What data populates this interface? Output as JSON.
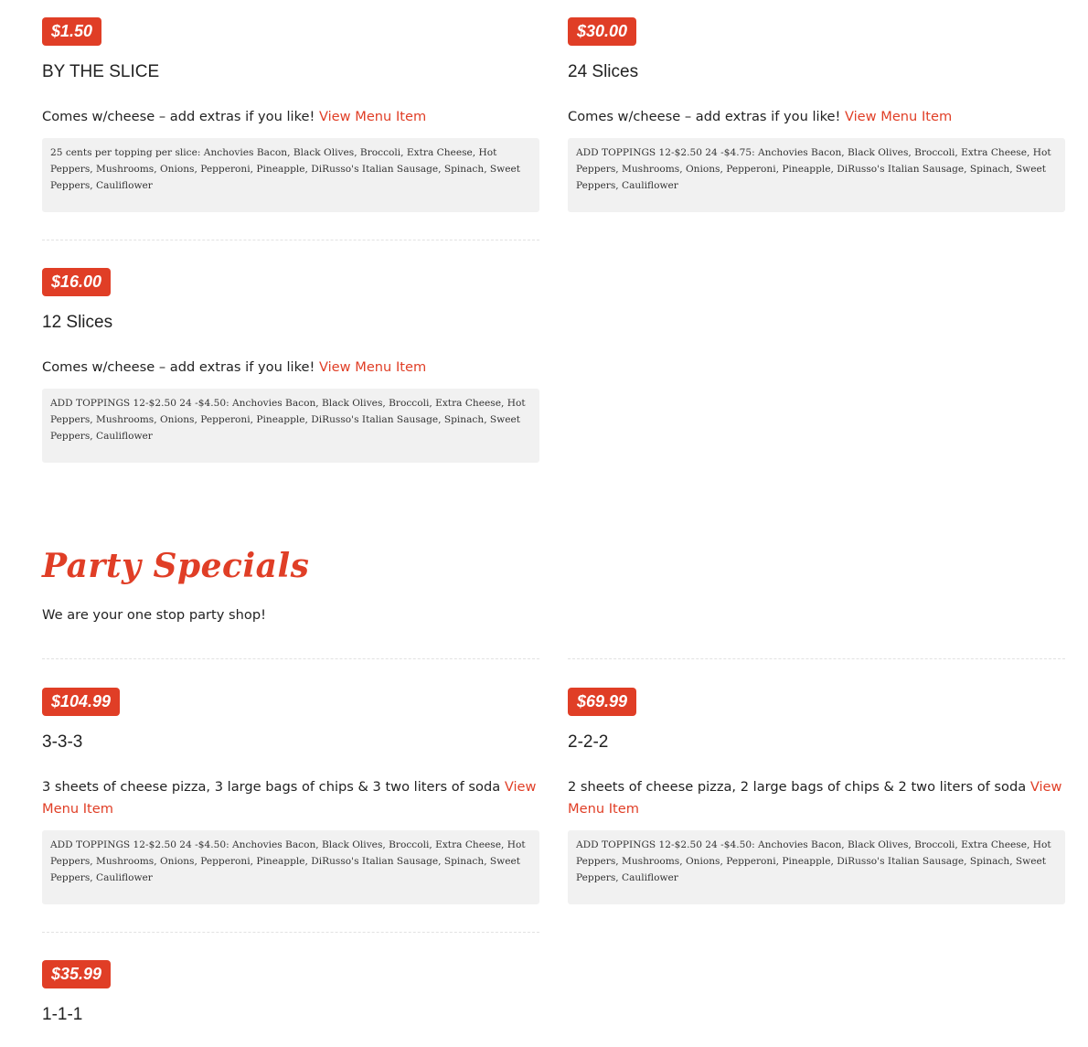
{
  "link_label": "View Menu Item",
  "items": [
    {
      "price": "$1.50",
      "name": "BY THE SLICE",
      "description": "Comes w/cheese – add extras if you like!",
      "toppings": "25 cents per topping per slice: Anchovies Bacon, Black Olives, Broccoli, Extra Cheese, Hot Peppers, Mushrooms, Onions, Pepperoni, Pineapple, DiRusso's Italian Sausage, Spinach, Sweet Peppers, Cauliflower"
    },
    {
      "price": "$30.00",
      "name": "24 Slices",
      "description": "Comes w/cheese – add extras if you like!",
      "toppings": "ADD TOPPINGS 12-$2.50 24 -$4.75: Anchovies Bacon, Black Olives, Broccoli, Extra Cheese, Hot Peppers, Mushrooms, Onions, Pepperoni, Pineapple, DiRusso's Italian Sausage, Spinach, Sweet Peppers, Cauliflower"
    },
    {
      "price": "$16.00",
      "name": "12 Slices",
      "description": "Comes w/cheese – add extras if you like!",
      "toppings": "ADD TOPPINGS 12-$2.50 24 -$4.50: Anchovies Bacon, Black Olives, Broccoli, Extra Cheese, Hot Peppers, Mushrooms, Onions, Pepperoni, Pineapple, DiRusso's Italian Sausage, Spinach, Sweet Peppers, Cauliflower"
    }
  ],
  "party": {
    "title": "Party Specials",
    "subtitle": "We are your one stop party shop!",
    "items": [
      {
        "price": "$104.99",
        "name": "3-3-3",
        "description": "3 sheets of cheese pizza, 3 large bags of chips & 3 two liters of soda",
        "toppings": "ADD TOPPINGS 12-$2.50 24 -$4.50: Anchovies Bacon, Black Olives, Broccoli, Extra Cheese, Hot Peppers, Mushrooms, Onions, Pepperoni, Pineapple, DiRusso's Italian Sausage, Spinach, Sweet Peppers, Cauliflower"
      },
      {
        "price": "$69.99",
        "name": "2-2-2",
        "description": "2 sheets of cheese pizza, 2 large bags of chips & 2 two liters of soda",
        "toppings": "ADD TOPPINGS 12-$2.50 24 -$4.50: Anchovies Bacon, Black Olives, Broccoli, Extra Cheese, Hot Peppers, Mushrooms, Onions, Pepperoni, Pineapple, DiRusso's Italian Sausage, Spinach, Sweet Peppers, Cauliflower"
      },
      {
        "price": "$35.99",
        "name": "1-1-1"
      }
    ]
  }
}
